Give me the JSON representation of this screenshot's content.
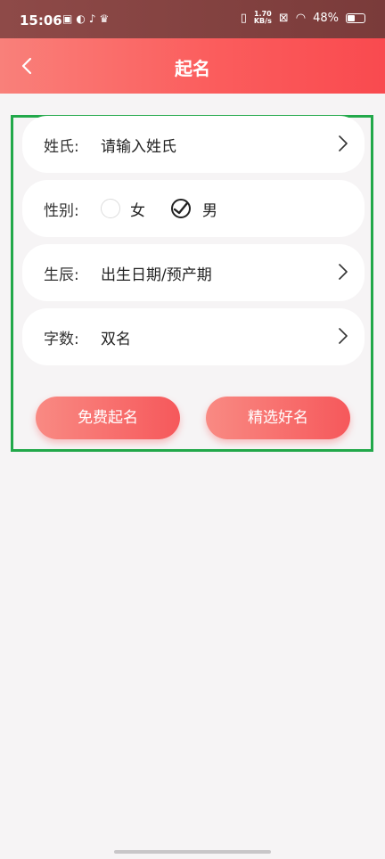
{
  "status_bar": {
    "time": "15:06",
    "net_speed_value": "1.70",
    "net_speed_unit": "KB/s",
    "battery": "48%",
    "battery_level": 0.48
  },
  "header": {
    "title": "起名"
  },
  "form": {
    "surname": {
      "label": "姓氏:",
      "placeholder": "请输入姓氏"
    },
    "gender": {
      "label": "性别:",
      "options": [
        "女",
        "男"
      ],
      "selected": "男"
    },
    "birth": {
      "label": "生辰:",
      "placeholder": "出生日期/预产期"
    },
    "count": {
      "label": "字数:",
      "value": "双名"
    }
  },
  "actions": {
    "free_label": "免费起名",
    "select_label": "精选好名"
  },
  "colors": {
    "accent": "#fb5d5d",
    "frame": "#22a84a"
  }
}
